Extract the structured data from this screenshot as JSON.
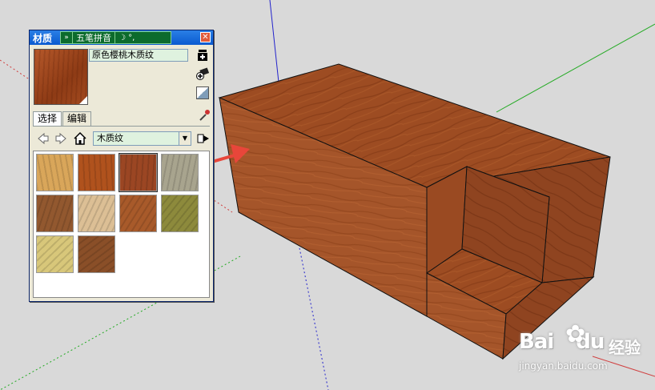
{
  "materials_window": {
    "title": "材质",
    "close_label": "✕",
    "ime_bar": {
      "chevron": "»",
      "label": "五笔拼音",
      "moon": "☽ °,"
    },
    "material_name": "原色樱桃木质纹",
    "tabs": [
      "选择",
      "编辑"
    ],
    "collection": "木质纹",
    "icons": {
      "create": "create-material-icon",
      "sample": "sample-paint-icon",
      "display": "display-secondary-pane-icon",
      "eyedropper": "eyedropper-icon",
      "back": "back-arrow-icon",
      "forward": "forward-arrow-icon",
      "home": "home-icon",
      "details": "details-arrow-icon"
    },
    "swatch_colors": [
      "#d9a65a",
      "#b0521d",
      "#9b4623",
      "#a8a48e",
      "#92582f",
      "#dcbf95",
      "#a85a2a",
      "#8d8a3c",
      "#d8c77a",
      "#8a4f28"
    ]
  },
  "watermark": {
    "logo": "Bai",
    "logo_suffix": "du",
    "label": "经验",
    "url": "jingyan.baidu.com"
  },
  "accent_colors": {
    "wood": "#a5552a",
    "red_arrow": "#e8463a",
    "axis_blue": "#2222cc",
    "axis_green": "#22aa22"
  }
}
